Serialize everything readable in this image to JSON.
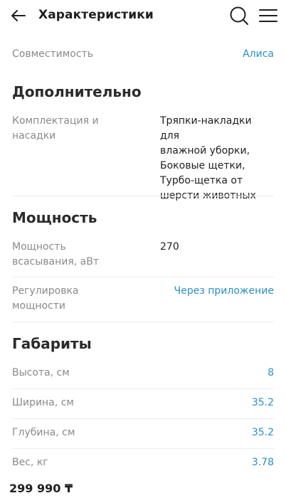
{
  "header": {
    "title": "Характеристики",
    "back_icon": "arrow-left-icon",
    "search_icon": "search-icon",
    "menu_icon": "hamburger-menu-icon"
  },
  "compatibility": {
    "label": "Совместимость",
    "value": "Алиса"
  },
  "sections": {
    "additional": {
      "title": "Дополнительно",
      "equipment_label_line1": "Комплектация и",
      "equipment_label_line2": "насадки",
      "equipment_value": [
        "Тряпки-накладки для",
        "влажной уборки,",
        "Боковые щетки,",
        "Турбо-щетка от",
        "шерсти животных"
      ]
    },
    "power": {
      "title": "Мощность",
      "suction_label_line1": "Мощность",
      "suction_label_line2": "всасывания, аВт",
      "suction_value": "270",
      "regulation_label_line1": "Регулировка",
      "regulation_label_line2": "мощности",
      "regulation_value": "Через приложение"
    },
    "dimensions": {
      "title": "Габариты",
      "rows": [
        {
          "label": "Высота, см",
          "value": "8"
        },
        {
          "label": "Ширина, см",
          "value": "35.2"
        },
        {
          "label": "Глубина, см",
          "value": "35.2"
        },
        {
          "label": "Вес, кг",
          "value": "3.78"
        }
      ]
    }
  },
  "footer": {
    "price": "299 990 ₸"
  },
  "colors": {
    "accent": "#2a8fc9",
    "label": "#8a8a8a",
    "text": "#1f1f1f",
    "divider": "#ececec"
  }
}
